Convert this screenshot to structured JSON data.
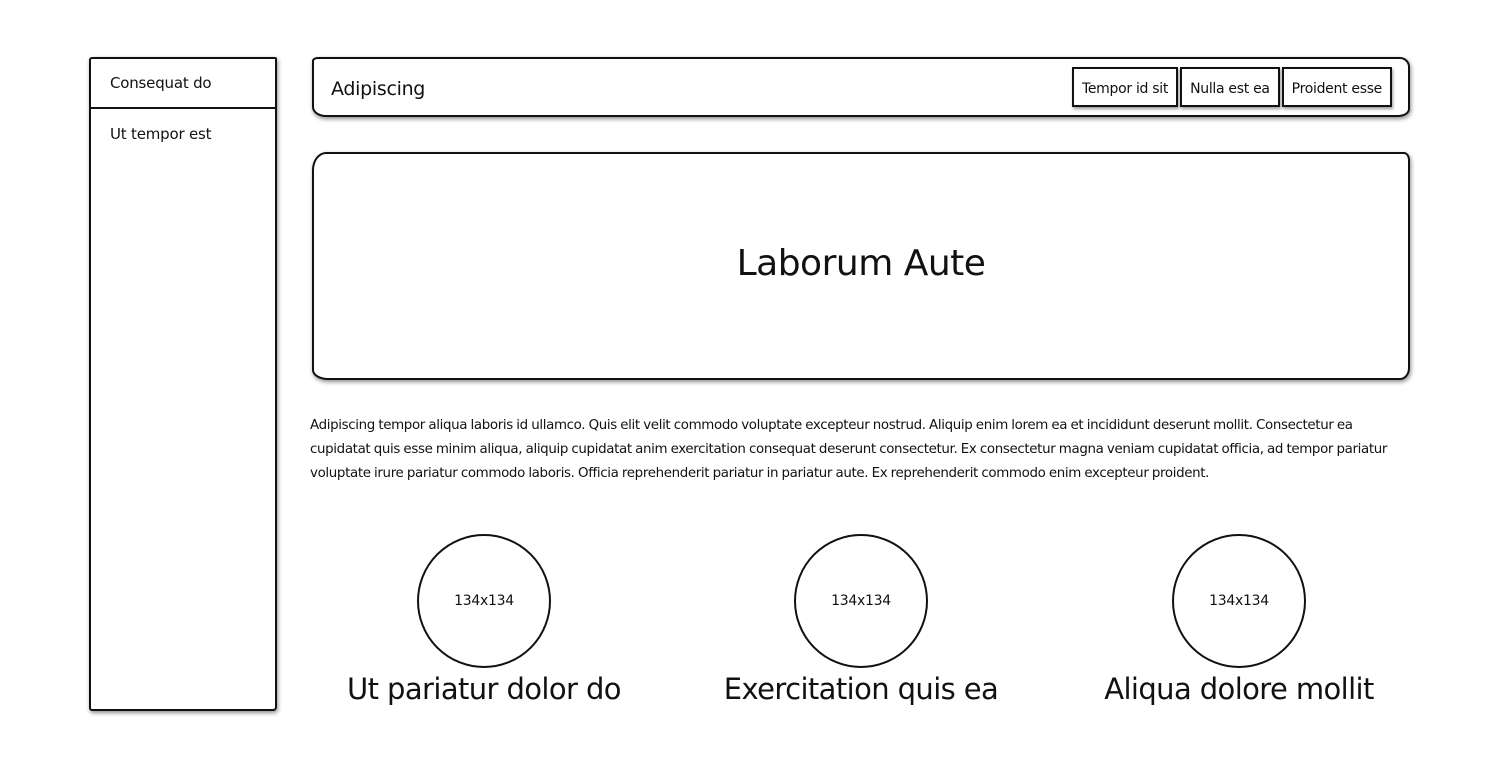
{
  "sidebar": {
    "items": [
      {
        "label": "Consequat do"
      },
      {
        "label": "Ut tempor est"
      }
    ]
  },
  "header": {
    "brand": "Adipiscing",
    "nav": [
      {
        "label": "Tempor id sit"
      },
      {
        "label": "Nulla est ea"
      },
      {
        "label": "Proident esse"
      }
    ]
  },
  "hero": {
    "title": "Laborum Aute"
  },
  "intro": {
    "text": "Adipiscing tempor aliqua laboris id ullamco. Quis elit velit commodo voluptate excepteur nostrud. Aliquip enim lorem ea et incididunt deserunt mollit. Consectetur ea cupidatat quis esse minim aliqua, aliquip cupidatat anim exercitation consequat deserunt consectetur. Ex consectetur magna veniam cupidatat officia, ad tempor pariatur voluptate irure pariatur commodo laboris. Officia reprehenderit pariatur in pariatur aute. Ex reprehenderit commodo enim excepteur proident."
  },
  "features": [
    {
      "image_label": "134x134",
      "title": "Ut pariatur dolor do"
    },
    {
      "image_label": "134x134",
      "title": "Exercitation quis ea"
    },
    {
      "image_label": "134x134",
      "title": "Aliqua dolore mollit"
    }
  ]
}
